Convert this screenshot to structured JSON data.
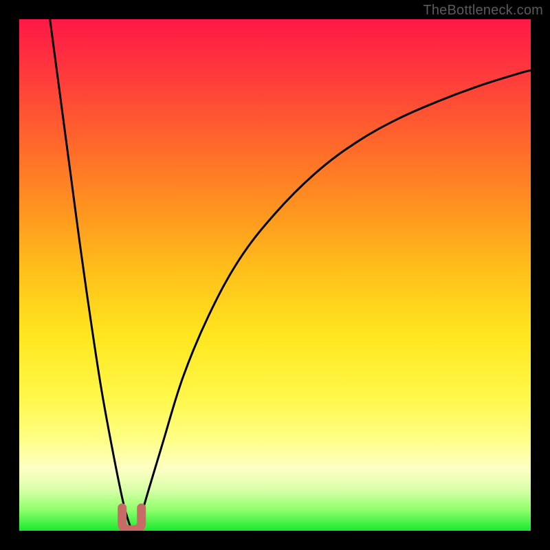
{
  "watermark": "TheBottleneck.com",
  "chart_data": {
    "type": "line",
    "title": "",
    "xlabel": "",
    "ylabel": "",
    "xlim": [
      0,
      100
    ],
    "ylim": [
      0,
      100
    ],
    "grid": false,
    "legend": false,
    "notes": "Vertical gradient from red (top, high bottleneck) through orange/yellow to green (bottom, no bottleneck). Two black curves descending to a shared minimum near x≈22; small salmon U-shaped marker at the minimum.",
    "series": [
      {
        "name": "curve-left",
        "x": [
          6,
          8,
          10,
          12,
          14,
          16,
          18,
          20,
          21,
          22
        ],
        "y": [
          100,
          85,
          70,
          55,
          41,
          28,
          17,
          7,
          3,
          0
        ]
      },
      {
        "name": "curve-right",
        "x": [
          23,
          25,
          28,
          32,
          37,
          43,
          50,
          58,
          66,
          74,
          82,
          90,
          98,
          100
        ],
        "y": [
          0,
          7,
          17,
          30,
          42,
          53,
          62,
          70,
          76,
          80.5,
          84,
          87,
          89.5,
          90
        ]
      }
    ],
    "marker": {
      "name": "minimum-marker",
      "x": 22,
      "y": 1.5,
      "color": "#c96a66"
    },
    "background_gradient_stops": [
      {
        "pos": 0,
        "color": "#ff1846"
      },
      {
        "pos": 50,
        "color": "#ffc21a"
      },
      {
        "pos": 82,
        "color": "#ffff85"
      },
      {
        "pos": 100,
        "color": "#18e82f"
      }
    ]
  }
}
